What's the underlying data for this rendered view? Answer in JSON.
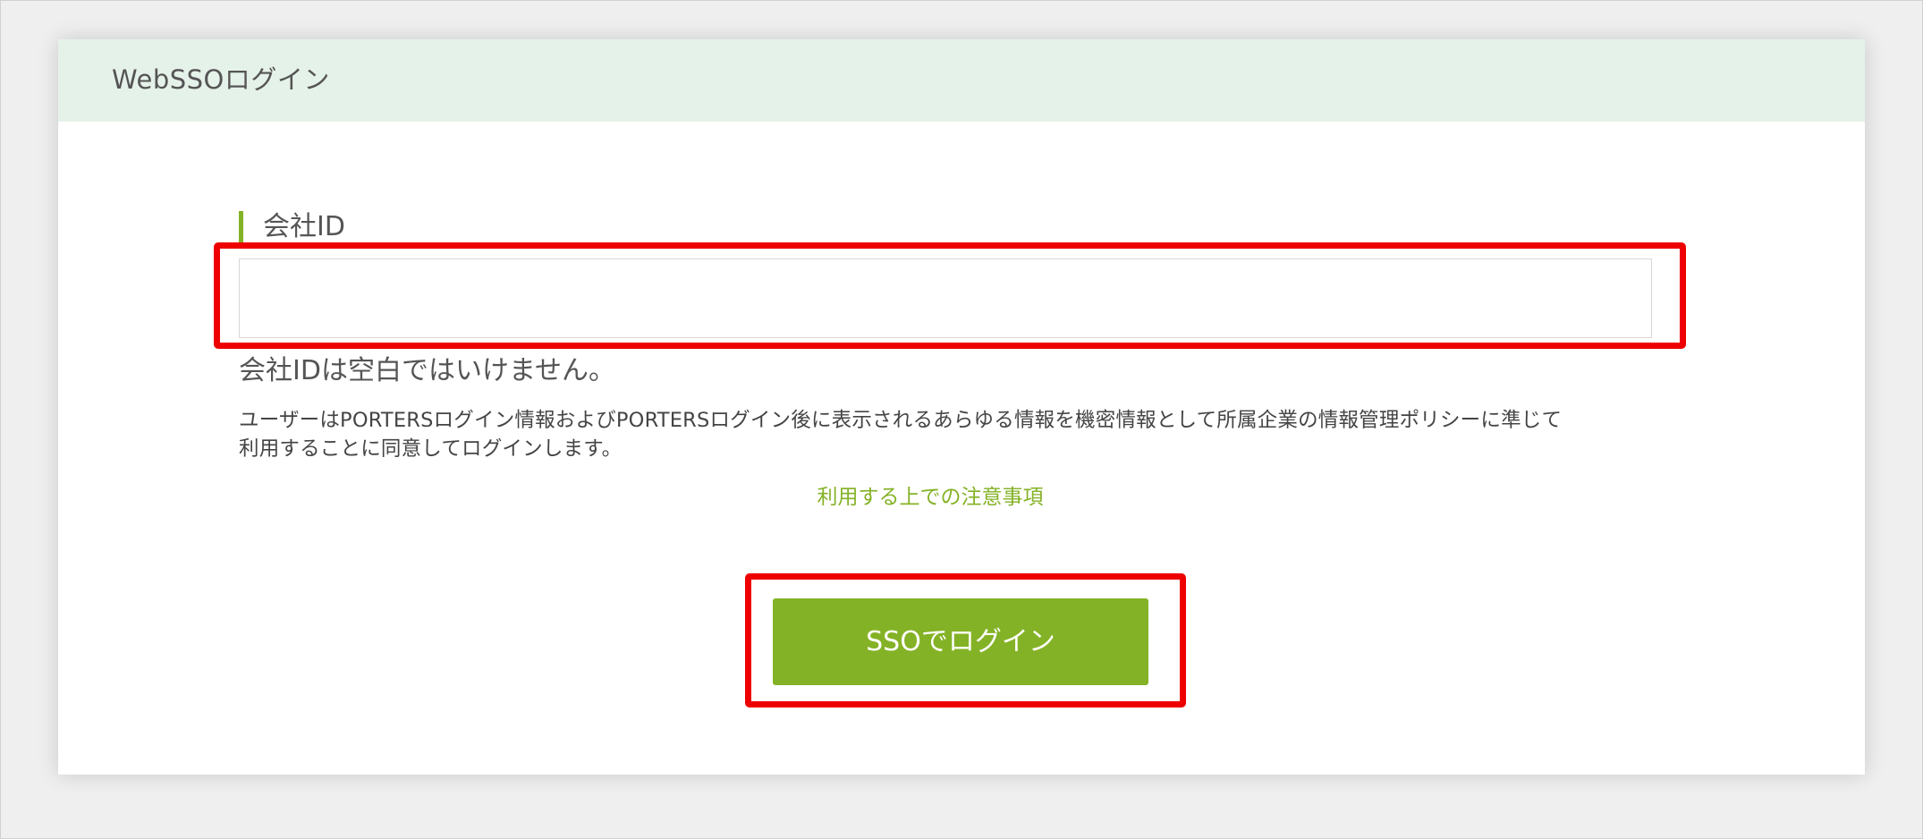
{
  "header": {
    "title": "WebSSOログイン"
  },
  "form": {
    "company_id_label": "会社ID",
    "company_id_value": "",
    "error_message": "会社IDは空白ではいけません。",
    "consent_line1": "ユーザーはPORTERSログイン情報およびPORTERSログイン後に表示されるあらゆる情報を機密情報として所属企業の情報管理ポリシーに準じて",
    "consent_line2": "利用することに同意してログインします。",
    "notes_link": "利用する上での注意事項",
    "submit_label": "SSOでログイン"
  },
  "colors": {
    "accent": "#84b226",
    "header_background": "#e5f2e9",
    "highlight": "#ee0000",
    "page_background": "#efefef"
  }
}
